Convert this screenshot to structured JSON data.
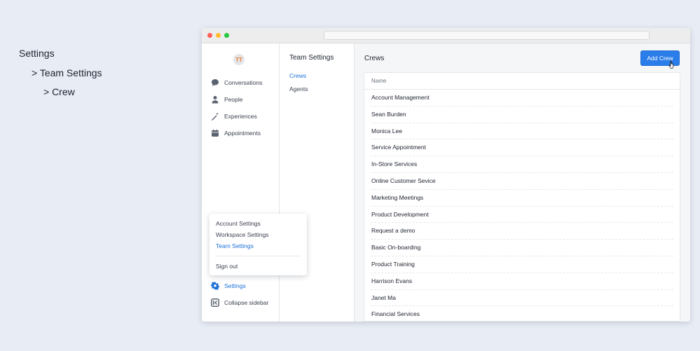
{
  "breadcrumb": {
    "level1": "Settings",
    "level2": "> Team Settings",
    "level3": "> Crew"
  },
  "sidebar": {
    "logo_text": "TT",
    "items": [
      {
        "label": "Conversations",
        "icon": "chat-bubble-icon"
      },
      {
        "label": "People",
        "icon": "person-icon"
      },
      {
        "label": "Experiences",
        "icon": "magic-wand-icon"
      },
      {
        "label": "Appointments",
        "icon": "calendar-icon"
      }
    ],
    "settings_label": "Settings",
    "collapse_label": "Collapse sidebar"
  },
  "settings_menu": {
    "items": [
      "Account Settings",
      "Workspace Settings",
      "Team Settings"
    ],
    "active": "Team Settings",
    "sign_out": "Sign out"
  },
  "subnav": {
    "title": "Team Settings",
    "items": [
      "Crews",
      "Agents"
    ],
    "active": "Crews"
  },
  "main": {
    "title": "Crews",
    "add_button": "Add Crew",
    "column_header": "Name",
    "rows": [
      "Account Management",
      "Sean Burden",
      "Monica Lee",
      "Service Appointment",
      "In-Store Services",
      "Online Customer Sevice",
      "Marketing Meetings",
      "Product Development",
      "Request a demo",
      "Basic On-boarding",
      "Product Training",
      "Harrison Evans",
      "Janet Ma",
      "Financial Services"
    ]
  },
  "colors": {
    "accent": "#2b7de9",
    "active_text": "#1b6fd6",
    "background": "#e8ecf4"
  }
}
